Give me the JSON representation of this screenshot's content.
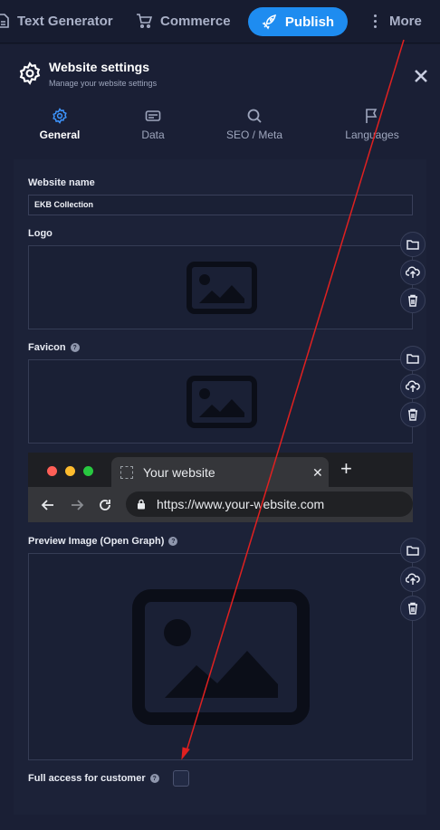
{
  "topbar": {
    "text_generator": "Text Generator",
    "commerce": "Commerce",
    "publish": "Publish",
    "more": "More"
  },
  "panel": {
    "title": "Website settings",
    "subtitle": "Manage your website settings"
  },
  "tabs": [
    {
      "label": "General",
      "icon": "gear-icon",
      "active": true
    },
    {
      "label": "Data",
      "icon": "database-icon",
      "active": false
    },
    {
      "label": "SEO / Meta",
      "icon": "search-icon",
      "active": false
    },
    {
      "label": "Languages",
      "icon": "flag-icon",
      "active": false
    }
  ],
  "form": {
    "website_name_label": "Website name",
    "website_name_value": "EKB Collection",
    "logo_label": "Logo",
    "favicon_label": "Favicon",
    "preview_label": "Preview Image (Open Graph)",
    "full_access_label": "Full access for customer"
  },
  "browser_preview": {
    "tab_title": "Your website",
    "url": "https://www.your-website.com"
  },
  "colors": {
    "accent": "#1e8cf0",
    "background": "#161b2e",
    "annotation": "#e02020"
  }
}
